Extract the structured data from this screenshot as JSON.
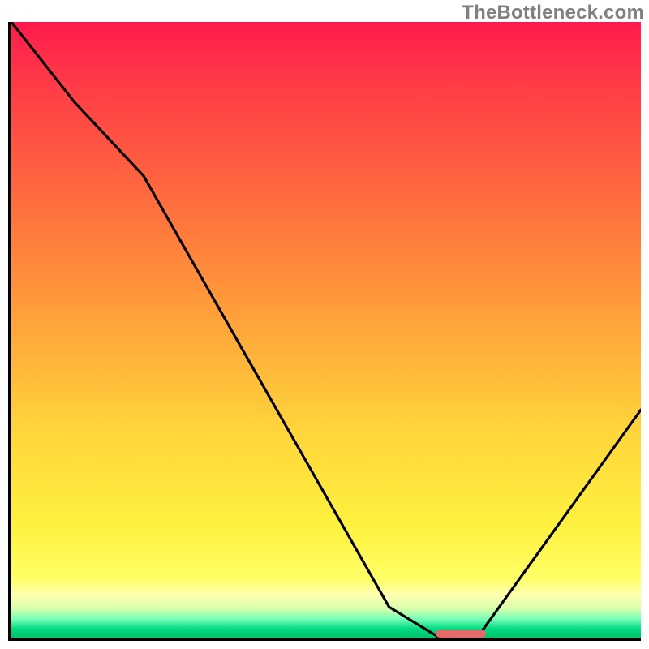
{
  "watermark": "TheBottleneck.com",
  "chart_data": {
    "type": "line",
    "title": "",
    "xlabel": "",
    "ylabel": "",
    "xlim": [
      0,
      100
    ],
    "ylim": [
      0,
      100
    ],
    "grid": false,
    "legend": false,
    "series": [
      {
        "name": "bottleneck-curve",
        "x": [
          0,
          10,
          21,
          60,
          68,
          74,
          100
        ],
        "values": [
          100,
          87,
          75,
          5,
          0,
          0,
          37
        ]
      }
    ],
    "optimum_marker": {
      "x_start": 67,
      "x_end": 75,
      "y": 0
    },
    "background_gradient": {
      "stops": [
        {
          "pos": 0.0,
          "color": "#ff1a4d"
        },
        {
          "pos": 0.48,
          "color": "#ffa13a"
        },
        {
          "pos": 0.82,
          "color": "#fff23f"
        },
        {
          "pos": 0.95,
          "color": "#d7ffab"
        },
        {
          "pos": 1.0,
          "color": "#00c46e"
        }
      ]
    }
  }
}
